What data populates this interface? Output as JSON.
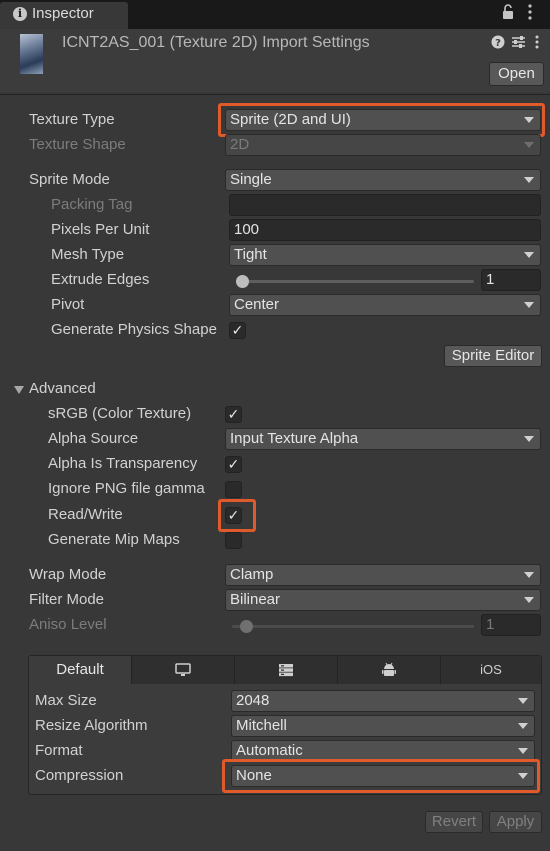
{
  "window": {
    "tab_label": "Inspector",
    "title": "ICNT2AS_001 (Texture 2D) Import Settings",
    "open_button": "Open"
  },
  "texture_type": {
    "label": "Texture Type",
    "value": "Sprite (2D and UI)"
  },
  "texture_shape": {
    "label": "Texture Shape",
    "value": "2D"
  },
  "sprite_mode": {
    "label": "Sprite Mode",
    "value": "Single"
  },
  "packing_tag": {
    "label": "Packing Tag",
    "value": ""
  },
  "pixels_per_unit": {
    "label": "Pixels Per Unit",
    "value": "100"
  },
  "mesh_type": {
    "label": "Mesh Type",
    "value": "Tight"
  },
  "extrude_edges": {
    "label": "Extrude Edges",
    "value": "1",
    "slider_fraction": 0.0
  },
  "pivot": {
    "label": "Pivot",
    "value": "Center"
  },
  "generate_physics_shape": {
    "label": "Generate Physics Shape",
    "checked": true
  },
  "sprite_editor_button": "Sprite Editor",
  "advanced": {
    "label": "Advanced",
    "srgb": {
      "label": "sRGB (Color Texture)",
      "checked": true
    },
    "alpha_source": {
      "label": "Alpha Source",
      "value": "Input Texture Alpha"
    },
    "alpha_is_transparency": {
      "label": "Alpha Is Transparency",
      "checked": true
    },
    "ignore_png_gamma": {
      "label": "Ignore PNG file gamma",
      "checked": false
    },
    "read_write": {
      "label": "Read/Write",
      "checked": true
    },
    "generate_mip_maps": {
      "label": "Generate Mip Maps",
      "checked": false
    }
  },
  "wrap_mode": {
    "label": "Wrap Mode",
    "value": "Clamp"
  },
  "filter_mode": {
    "label": "Filter Mode",
    "value": "Bilinear"
  },
  "aniso_level": {
    "label": "Aniso Level",
    "value": "1",
    "slider_fraction": 0.0
  },
  "platform": {
    "tabs": [
      {
        "label": "Default",
        "icon": ""
      },
      {
        "label": "",
        "icon": "monitor-icon"
      },
      {
        "label": "",
        "icon": "server-icon"
      },
      {
        "label": "",
        "icon": "android-icon"
      },
      {
        "label": "iOS",
        "icon": ""
      }
    ],
    "max_size": {
      "label": "Max Size",
      "value": "2048"
    },
    "resize_algorithm": {
      "label": "Resize Algorithm",
      "value": "Mitchell"
    },
    "format": {
      "label": "Format",
      "value": "Automatic"
    },
    "compression": {
      "label": "Compression",
      "value": "None"
    }
  },
  "footer": {
    "revert": "Revert",
    "apply": "Apply"
  },
  "colors": {
    "highlight": "#e05a2c",
    "background": "#383838",
    "field": "#505050"
  }
}
